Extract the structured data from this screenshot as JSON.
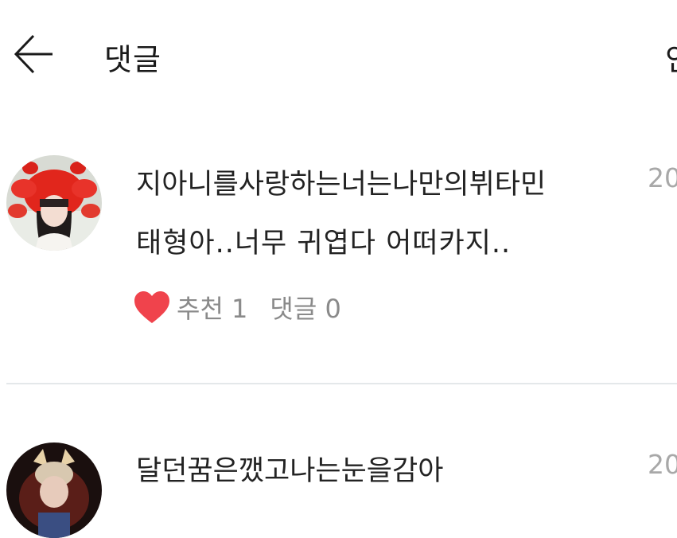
{
  "header": {
    "title": "댓글",
    "right_partial": "인"
  },
  "comments": [
    {
      "username": "지아니를사랑하는너는나만의뷔타민",
      "date": "20",
      "text": "태형아..너무 귀엽다 어떠카지..",
      "like_label": "추천 1",
      "reply_label": "댓글 0",
      "heart_color": "#f0434c"
    },
    {
      "username": "달던꿈은깼고나는눈을감아",
      "date": "20",
      "text": "",
      "like_label": "",
      "reply_label": ""
    }
  ]
}
